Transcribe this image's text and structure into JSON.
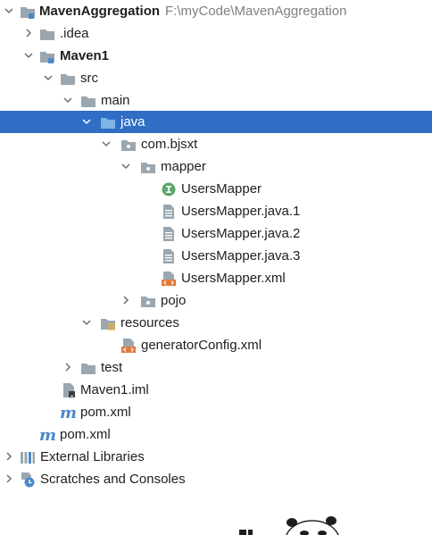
{
  "colors": {
    "selection": "#2f6ec4",
    "folder_gray": "#9aa7b0",
    "folder_blue": "#4c88c8",
    "interface_green": "#59a869",
    "xml_orange": "#e27a3e"
  },
  "tree": {
    "root": {
      "name": "MavenAggregation",
      "path": "F:\\myCode\\MavenAggregation",
      "icon": "module-folder-icon"
    },
    "idea": {
      "name": ".idea",
      "icon": "folder-icon"
    },
    "maven1": {
      "name": "Maven1",
      "icon": "module-folder-icon"
    },
    "src": {
      "name": "src",
      "icon": "folder-icon"
    },
    "main": {
      "name": "main",
      "icon": "folder-icon"
    },
    "java": {
      "name": "java",
      "icon": "source-root-icon",
      "selected": true
    },
    "package": {
      "name": "com.bjsxt",
      "icon": "package-icon"
    },
    "mapper": {
      "name": "mapper",
      "icon": "package-icon"
    },
    "files": [
      {
        "name": "UsersMapper",
        "icon": "interface-icon"
      },
      {
        "name": "UsersMapper.java.1",
        "icon": "text-file-icon"
      },
      {
        "name": "UsersMapper.java.2",
        "icon": "text-file-icon"
      },
      {
        "name": "UsersMapper.java.3",
        "icon": "text-file-icon"
      },
      {
        "name": "UsersMapper.xml",
        "icon": "xml-file-icon"
      }
    ],
    "pojo": {
      "name": "pojo",
      "icon": "package-icon"
    },
    "resources": {
      "name": "resources",
      "icon": "resources-folder-icon"
    },
    "generator": {
      "name": "generatorConfig.xml",
      "icon": "xml-file-icon"
    },
    "test": {
      "name": "test",
      "icon": "folder-icon"
    },
    "iml": {
      "name": "Maven1.iml",
      "icon": "iml-file-icon"
    },
    "pom_module": {
      "name": "pom.xml",
      "icon": "maven-icon"
    },
    "pom_root": {
      "name": "pom.xml",
      "icon": "maven-icon"
    },
    "external": {
      "name": "External Libraries",
      "icon": "library-icon"
    },
    "scratches": {
      "name": "Scratches and Consoles",
      "icon": "scratches-icon"
    }
  },
  "maven_glyph": "m"
}
